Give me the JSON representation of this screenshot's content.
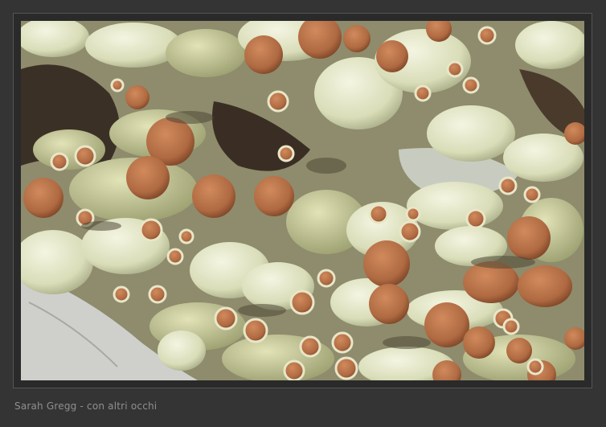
{
  "caption": "Sarah Gregg - con altri occhi",
  "colors": {
    "background": "#343434",
    "lichen": "#dfe3c2",
    "apothecia": "#b8724a",
    "bark": "#3a2e24"
  }
}
